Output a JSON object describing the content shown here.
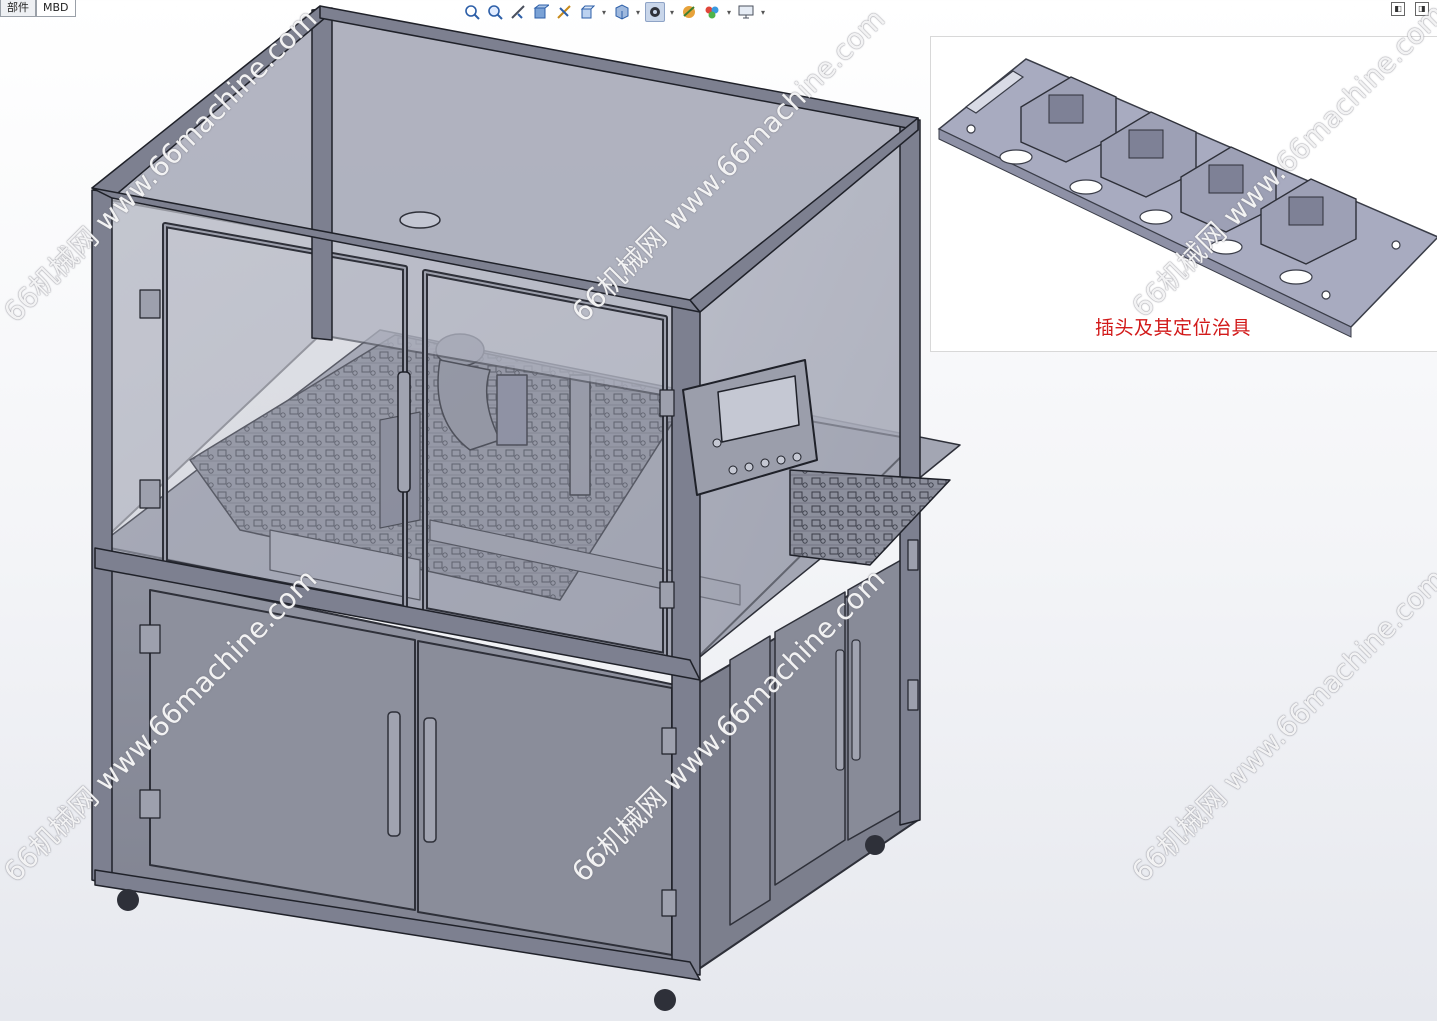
{
  "tabs": [
    {
      "label": "部件"
    },
    {
      "label": "MBD"
    }
  ],
  "toolbar": {
    "icons": [
      "zoom-fit-icon",
      "zoom-area-icon",
      "previous-view-icon",
      "section-view-icon",
      "dynamic-annotation-icon",
      "view-orientation-icon",
      "display-style-icon",
      "hide-show-icon",
      "edit-appearance-icon",
      "apply-scene-icon",
      "view-settings-icon"
    ],
    "active_icon": "display-style-icon"
  },
  "inset": {
    "caption": "插头及其定位治具"
  },
  "watermark": {
    "site_cn": "66机械网",
    "site_url": "www.66machine.com"
  },
  "colors": {
    "frame": "#6b7080",
    "glass": "#a7aab8",
    "panel": "#8a8d9a",
    "caption": "#d21a1a"
  }
}
